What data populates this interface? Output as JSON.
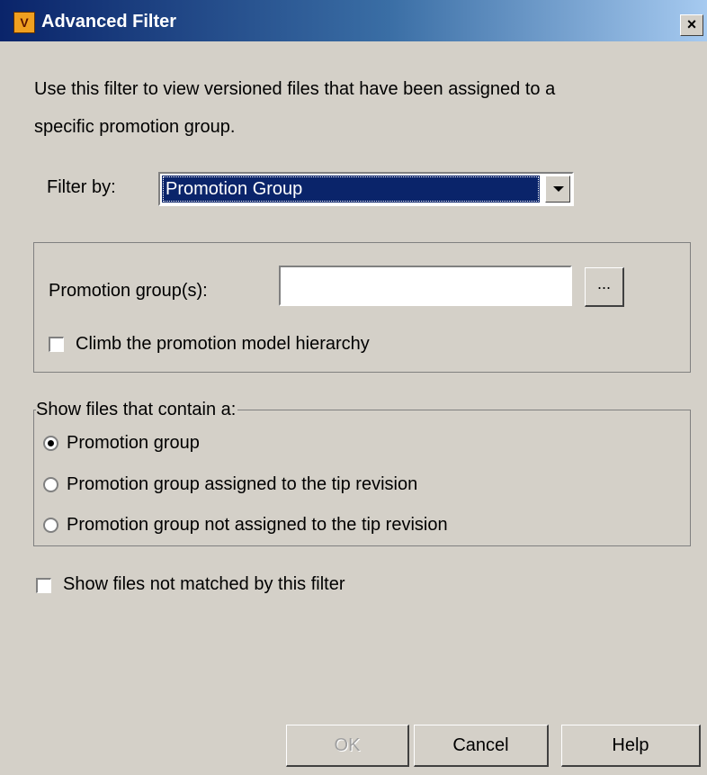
{
  "window": {
    "title": "Advanced Filter",
    "icon": "app-logo-icon",
    "close_label": "×"
  },
  "description": {
    "line1": "Use this filter to view versioned files that have been assigned to a",
    "line2": "specific promotion group."
  },
  "filter_by": {
    "label": "Filter by:",
    "selected": "Promotion Group"
  },
  "promotion_group": {
    "label": "Promotion group(s):",
    "value": "",
    "browse_label": "...",
    "climb_checkbox_label": "Climb the promotion model hierarchy",
    "climb_checked": false
  },
  "show_files": {
    "legend": "Show files that contain a:",
    "options": [
      {
        "label": "Promotion group",
        "checked": true
      },
      {
        "label": "Promotion group assigned to the tip revision",
        "checked": false
      },
      {
        "label": "Promotion group not assigned to the tip revision",
        "checked": false
      }
    ]
  },
  "show_unmatched": {
    "label": "Show files not matched by this filter",
    "checked": false
  },
  "buttons": {
    "ok": "OK",
    "cancel": "Cancel",
    "help": "Help"
  },
  "colors": {
    "dialog_bg": "#d4d0c8",
    "titlebar_start": "#0a246a",
    "titlebar_end": "#a6caf0",
    "selection": "#0a246a"
  }
}
